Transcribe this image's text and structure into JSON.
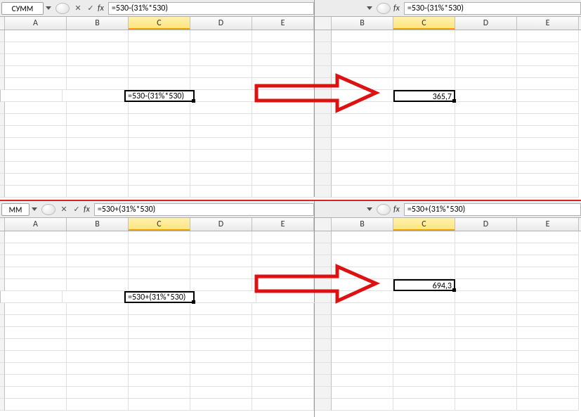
{
  "panels": {
    "tl": {
      "namebox": "СУММ",
      "cancel_glyph": "✕",
      "accept_glyph": "✓",
      "fx_glyph": "fx",
      "formula": "=530-(31%*530)",
      "columns": [
        "A",
        "B",
        "C",
        "D",
        "E"
      ],
      "active_cell_text": "=530-(31%*530)"
    },
    "tr": {
      "fx_glyph": "fx",
      "formula": "=530-(31%*530)",
      "columns": [
        "B",
        "C",
        "D",
        "E"
      ],
      "result": "365,7"
    },
    "bl": {
      "namebox": "MM",
      "cancel_glyph": "✕",
      "accept_glyph": "✓",
      "fx_glyph": "fx",
      "formula": "=530+(31%*530)",
      "columns": [
        "A",
        "B",
        "C",
        "D",
        "E"
      ],
      "active_cell_text": "=530+(31%*530)"
    },
    "br": {
      "fx_glyph": "fx",
      "formula": "=530+(31%*530)",
      "columns": [
        "B",
        "C",
        "D",
        "E"
      ],
      "result": "694,3"
    }
  }
}
